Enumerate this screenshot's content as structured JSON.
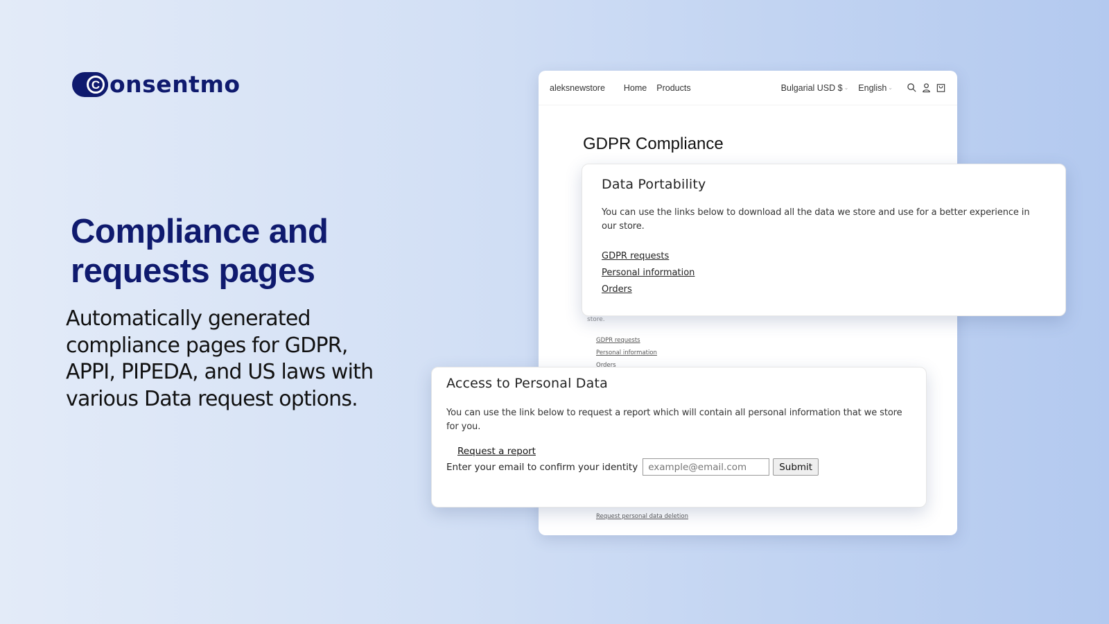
{
  "brand": {
    "logo_letter": "C",
    "logo_text": "onsentmo",
    "color": "#0f1a6e"
  },
  "hero": {
    "headline_line1": "Compliance and",
    "headline_line2": "requests pages",
    "subtext": "Automatically generated compliance pages for GDPR, APPI, PIPEDA, and US laws with various Data request options."
  },
  "store": {
    "name": "aleksnewstore",
    "nav": [
      "Home",
      "Products"
    ],
    "currency_selector": "Bulgarial USD $",
    "language_selector": "English",
    "icons": [
      "search-icon",
      "account-icon",
      "cart-icon"
    ],
    "page_title": "GDPR Compliance",
    "background_fragments": {
      "store_text": "store.",
      "links": [
        "GDPR requests",
        "Personal information",
        "Orders"
      ],
      "deletion_link": "Request personal data deletion"
    }
  },
  "portability_card": {
    "title": "Data Portability",
    "description": "You can use the links below to download all the data we store and use for a better experience in our store.",
    "links": [
      "GDPR requests",
      "Personal information",
      "Orders"
    ]
  },
  "access_card": {
    "title": "Access to Personal Data",
    "description": "You can use the link below to request a report which will contain all personal information that we store for you.",
    "request_link": "Request a report",
    "email_label": "Enter your email to confirm your identity",
    "email_placeholder": "example@email.com",
    "submit_label": "Submit"
  }
}
